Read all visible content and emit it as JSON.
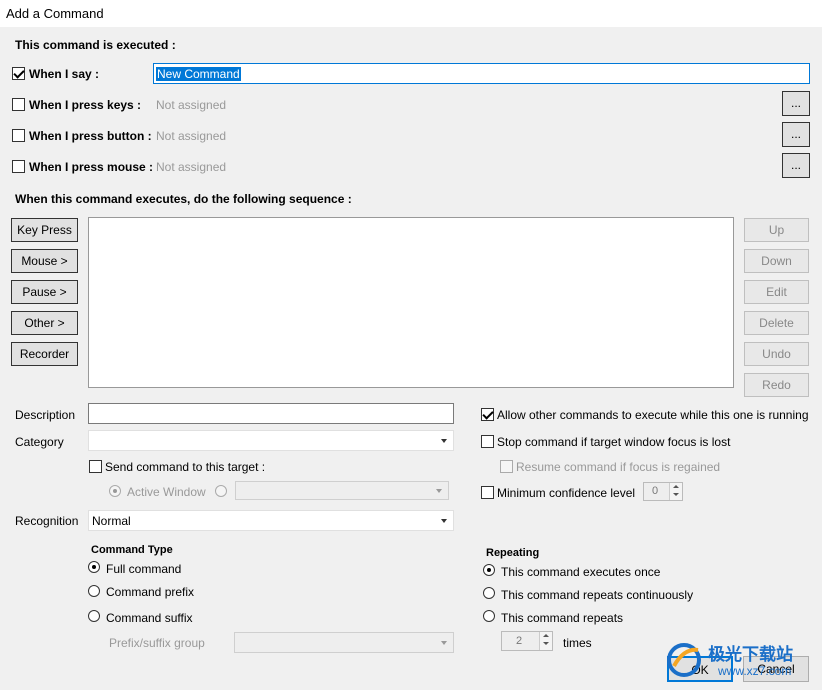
{
  "window": {
    "title": "Add a Command"
  },
  "executed_section": {
    "heading": "This command is executed :",
    "when_say": {
      "label": "When I say :",
      "checked": true,
      "value": "New Command"
    },
    "when_keys": {
      "label": "When I press keys :",
      "checked": false,
      "value": "Not assigned",
      "browse": "..."
    },
    "when_button": {
      "label": "When I press button :",
      "checked": false,
      "value": "Not assigned",
      "browse": "..."
    },
    "when_mouse": {
      "label": "When I press mouse :",
      "checked": false,
      "value": "Not assigned",
      "browse": "..."
    }
  },
  "sequence": {
    "heading": "When this command executes, do the following sequence :",
    "left_buttons": [
      "Key Press",
      "Mouse >",
      "Pause >",
      "Other >",
      "Recorder"
    ],
    "right_buttons": [
      "Up",
      "Down",
      "Edit",
      "Delete",
      "Undo",
      "Redo"
    ]
  },
  "details": {
    "description_label": "Description",
    "description_value": "",
    "category_label": "Category",
    "category_value": "",
    "send_target_label": "Send command to this target :",
    "active_window_label": "Active Window",
    "allow_other": "Allow other commands to execute while this one is running",
    "stop_focus": "Stop command if target window focus is lost",
    "resume_focus": "Resume command if focus is regained",
    "min_confidence": "Minimum confidence level",
    "min_confidence_value": "0"
  },
  "recognition": {
    "label": "Recognition",
    "value": "Normal"
  },
  "command_type": {
    "heading": "Command Type",
    "options": [
      "Full command",
      "Command prefix",
      "Command suffix"
    ],
    "selected": 0,
    "prefix_group_label": "Prefix/suffix group"
  },
  "repeating": {
    "heading": "Repeating",
    "options": [
      "This command executes once",
      "This command repeats continuously",
      "This command repeats"
    ],
    "selected": 0,
    "times_value": "2",
    "times_label": "times"
  },
  "footer": {
    "ok": "OK",
    "cancel": "Cancel"
  },
  "watermark": {
    "text": "极光下载站",
    "site": "www.xz7.com"
  }
}
